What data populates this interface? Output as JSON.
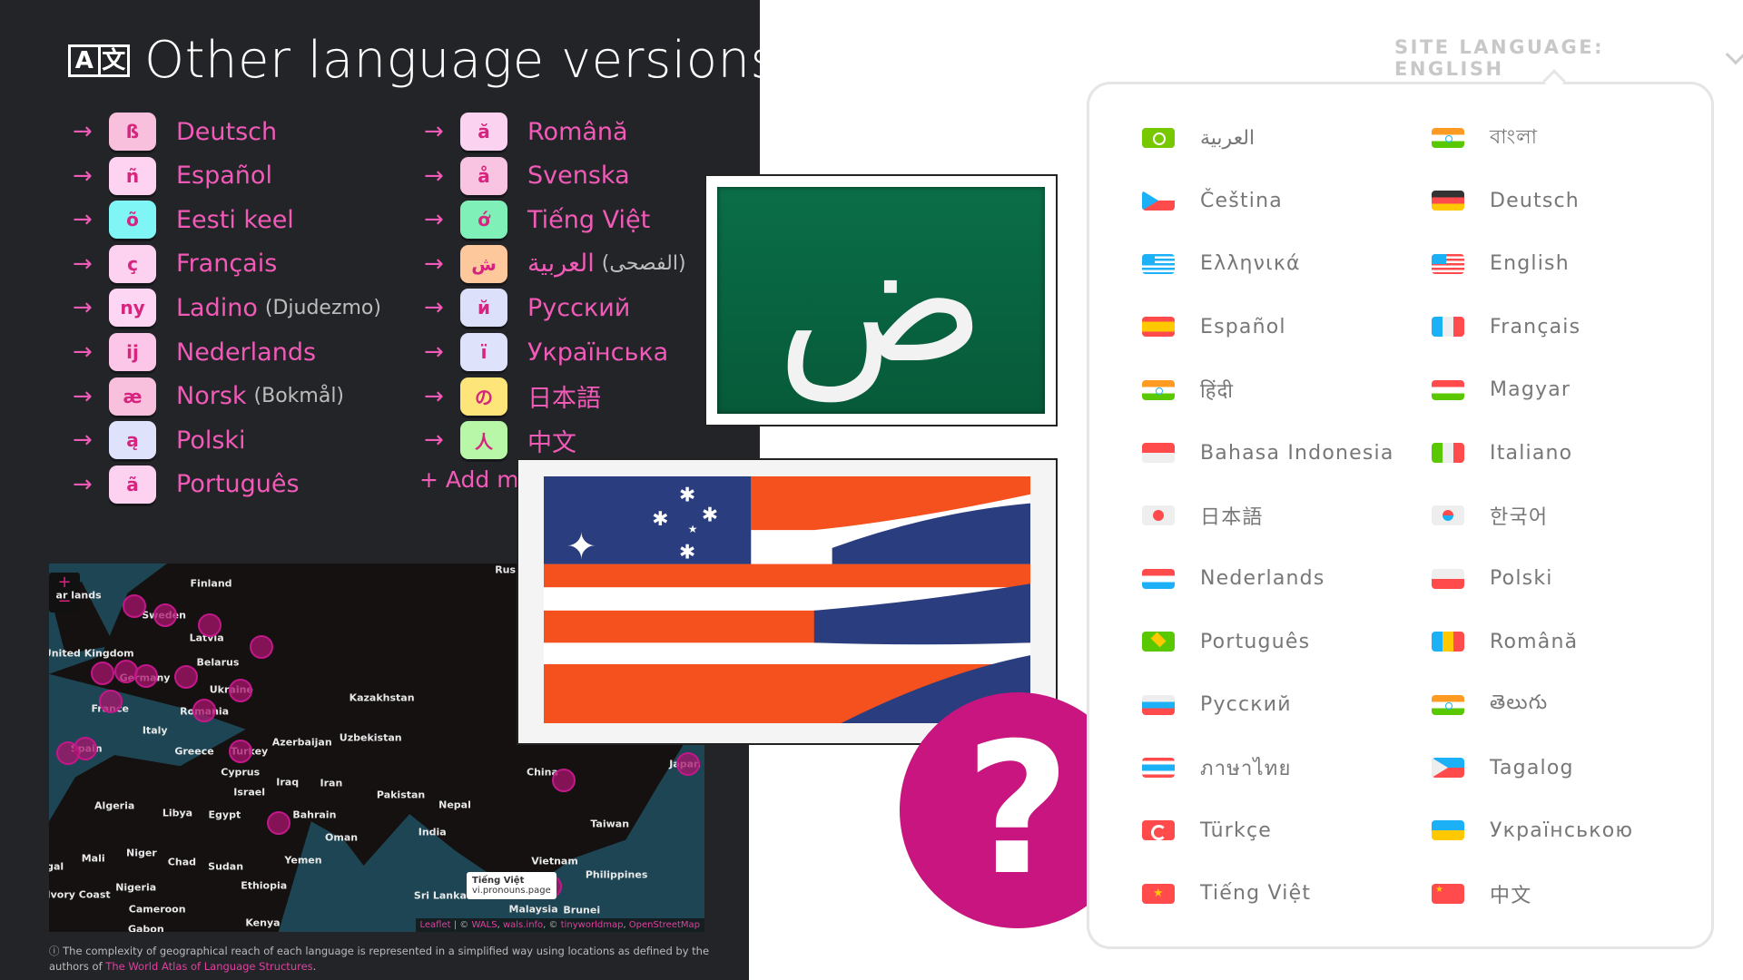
{
  "left_panel": {
    "title": "Other language versions",
    "title_icon": {
      "name": "translate-icon",
      "left": "A",
      "right": "文"
    },
    "arrow": "→",
    "col1": [
      {
        "badge": "ß",
        "badge_color": "#f9c0dd",
        "name": "Deutsch",
        "suffix": ""
      },
      {
        "badge": "ñ",
        "badge_color": "#fdd3f1",
        "name": "Español",
        "suffix": ""
      },
      {
        "badge": "õ",
        "badge_color": "#7ff5f5",
        "name": "Eesti keel",
        "suffix": ""
      },
      {
        "badge": "ç",
        "badge_color": "#fdd1f0",
        "name": "Français",
        "suffix": ""
      },
      {
        "badge": "ny",
        "badge_color": "#fdd6f3",
        "name": "Ladino",
        "suffix": "(Djudezmo)"
      },
      {
        "badge": "ij",
        "badge_color": "#fbc6e7",
        "name": "Nederlands",
        "suffix": ""
      },
      {
        "badge": "æ",
        "badge_color": "#f9c0dd",
        "name": "Norsk",
        "suffix": "(Bokmål)"
      },
      {
        "badge": "ą",
        "badge_color": "#dfe2fb",
        "name": "Polski",
        "suffix": ""
      },
      {
        "badge": "ã",
        "badge_color": "#fdd1f0",
        "name": "Português",
        "suffix": ""
      }
    ],
    "col2": [
      {
        "badge": "ă",
        "badge_color": "#fbd3f0",
        "name": "Română",
        "suffix": ""
      },
      {
        "badge": "å",
        "badge_color": "#f9c4e2",
        "name": "Svenska",
        "suffix": ""
      },
      {
        "badge": "ớ",
        "badge_color": "#7ff0b8",
        "name": "Tiếng Việt",
        "suffix": ""
      },
      {
        "badge": "ش",
        "badge_color": "#fdc89b",
        "name": "العربية",
        "suffix": "(الفصحى)"
      },
      {
        "badge": "й",
        "badge_color": "#dce0fb",
        "name": "Русский",
        "suffix": ""
      },
      {
        "badge": "ї",
        "badge_color": "#dfe2fb",
        "name": "Українська",
        "suffix": ""
      },
      {
        "badge": "の",
        "badge_color": "#fde57a",
        "name": "日本語",
        "suffix": ""
      },
      {
        "badge": "人",
        "badge_color": "#b8f7a8",
        "name": "中文",
        "suffix": ""
      }
    ],
    "add_more": "+ Add m"
  },
  "map": {
    "zoom_in": "+",
    "zoom_out": "−",
    "labels": [
      "Rus",
      "ar   lands",
      "Finland",
      "Sweden",
      "Latvia",
      "United Kingdom",
      "Belarus",
      "Germany",
      "Ukraine",
      "France",
      "Romania",
      "Italy",
      "Spain",
      "Greece",
      "Turkey",
      "Azerbaijan",
      "Uzbekistan",
      "Kazakhstan",
      "Cyprus",
      "Iraq",
      "Iran",
      "Israel",
      "Pakistan",
      "Nepal",
      "China",
      "Japan",
      "Algeria",
      "Libya",
      "Egypt",
      "Bahrain",
      "Oman",
      "India",
      "Taiwan",
      "Mali",
      "Niger",
      "Chad",
      "Sudan",
      "Yemen",
      "Vietnam",
      "Philippines",
      "Nigeria",
      "Ivory Coast",
      "Ethiopia",
      "Sri Lanka",
      "Malaysia",
      "Brunei",
      "Cameroon",
      "Kenya",
      "gal",
      "Gabon"
    ],
    "tooltip": {
      "title": "Tiếng Việt",
      "subtitle": "vi.pronouns.page"
    },
    "attribution": {
      "leaflet": "Leaflet",
      "sep": " | © ",
      "wals": "WALS",
      "comma": ", ",
      "wals_info": "wals.info",
      "sep2": ", © ",
      "tiny": "tinyworldmap",
      "comma2": ", ",
      "osm": "OpenStreetMap"
    },
    "marker_color": "#c2188a"
  },
  "caption": {
    "icon": "ⓘ",
    "text": " The complexity of geographical reach of each language is represented in a simplified way using locations as defined by the authors of ",
    "link": "The World Atlas of Language Structures",
    "end": "."
  },
  "arabic_image": {
    "glyph": "ض"
  },
  "question_mark": "?",
  "site_language": {
    "label": "SITE LANGUAGE: ENGLISH",
    "languages": [
      {
        "flag": "ar",
        "name": "العربية"
      },
      {
        "flag": "in",
        "name": "বাংলা"
      },
      {
        "flag": "cz",
        "name": "Čeština"
      },
      {
        "flag": "de",
        "name": "Deutsch"
      },
      {
        "flag": "el",
        "name": "Ελληνικά"
      },
      {
        "flag": "en",
        "name": "English"
      },
      {
        "flag": "es",
        "name": "Español"
      },
      {
        "flag": "fr",
        "name": "Français"
      },
      {
        "flag": "in",
        "name": "हिंदी"
      },
      {
        "flag": "hu",
        "name": "Magyar"
      },
      {
        "flag": "id",
        "name": "Bahasa Indonesia"
      },
      {
        "flag": "it",
        "name": "Italiano"
      },
      {
        "flag": "ja",
        "name": "日本語"
      },
      {
        "flag": "ko",
        "name": "한국어"
      },
      {
        "flag": "nl",
        "name": "Nederlands"
      },
      {
        "flag": "pl",
        "name": "Polski"
      },
      {
        "flag": "pt",
        "name": "Português"
      },
      {
        "flag": "ro",
        "name": "Română"
      },
      {
        "flag": "ru",
        "name": "Русский"
      },
      {
        "flag": "in",
        "name": "తెలుగు"
      },
      {
        "flag": "th",
        "name": "ภาษาไทย"
      },
      {
        "flag": "tl",
        "name": "Tagalog"
      },
      {
        "flag": "tr",
        "name": "Türkçe"
      },
      {
        "flag": "uk",
        "name": "Українською"
      },
      {
        "flag": "star",
        "name": "Tiếng Việt"
      },
      {
        "flag": "zh",
        "name": "中文"
      }
    ]
  },
  "colors": {
    "accent": "#f25ab8",
    "badge_text": "#d6247f",
    "dark_bg": "#232428",
    "question": "#c8157f"
  }
}
